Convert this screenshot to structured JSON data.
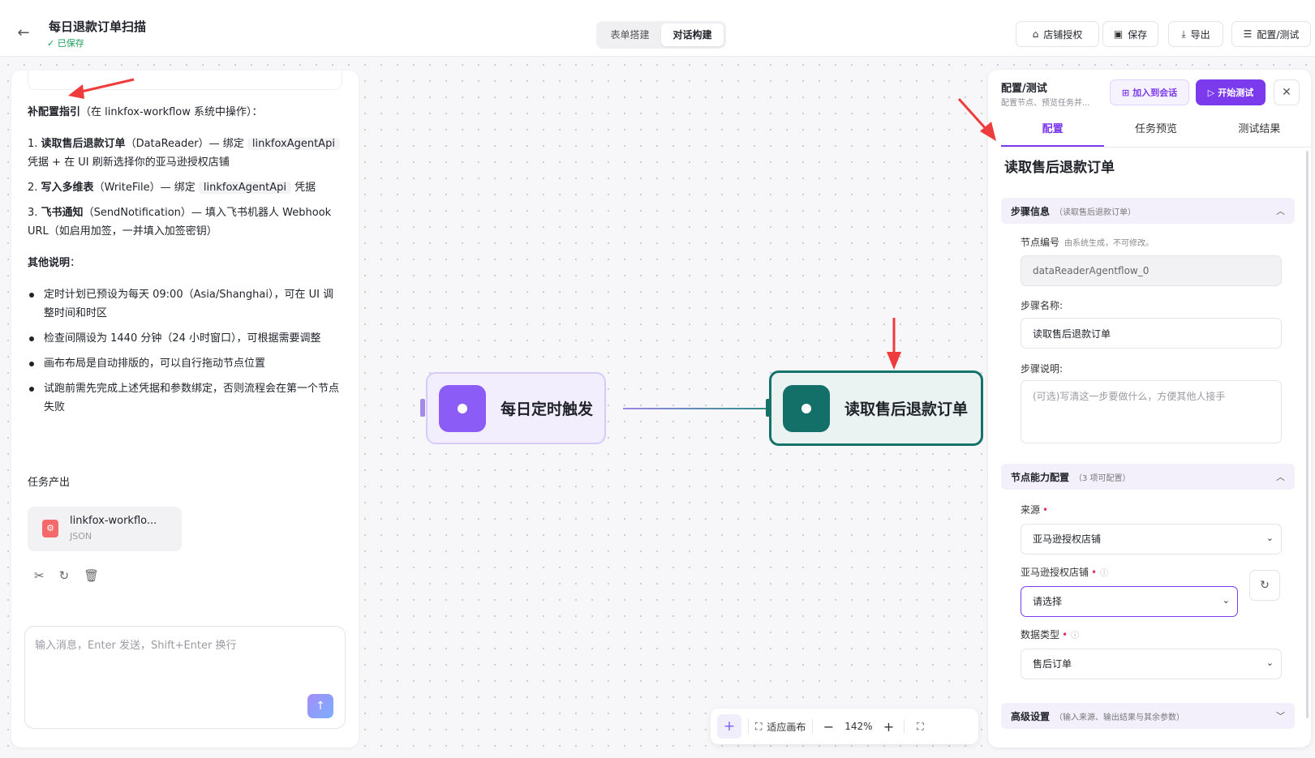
{
  "header": {
    "back_icon": "arrow-left-icon",
    "title": "每日退款订单扫描",
    "saved_status": "✓ 已保存",
    "mode_tabs": [
      "表单搭建",
      "对话构建"
    ],
    "active_mode": "对话构建",
    "actions": {
      "store_auth": "店铺授权",
      "save": "保存",
      "export": "导出",
      "config_test": "配置/测试"
    }
  },
  "chat": {
    "guide_title": "补配置指引",
    "guide_context": "（在 linkfox-workflow 系统中操作）：",
    "steps": [
      {
        "num": "1.",
        "name": "读取售后退款订单",
        "desc_a": "（DataReader）— 绑定 ",
        "code": "linkfoxAgentApi",
        "desc_b": " 凭据 + 在 UI 刷新选择你的亚马逊授权店铺"
      },
      {
        "num": "2.",
        "name": "写入多维表",
        "desc_a": "（WriteFile）— 绑定 ",
        "code": "linkfoxAgentApi",
        "desc_b": " 凭据"
      },
      {
        "num": "3.",
        "name": "飞书通知",
        "desc_a": "（SendNotification）— 填入飞书机器人 Webhook URL（如启用加签，一并填入加签密钥）",
        "code": "",
        "desc_b": ""
      }
    ],
    "other_title": "其他说明",
    "other_colon": "：",
    "notes": [
      "定时计划已预设为每天 09:00（Asia/Shanghai），可在 UI 调整时间和时区",
      "检查间隔设为 1440 分钟（24 小时窗口），可根据需要调整",
      "画布布局是自动排版的，可以自行拖动节点位置",
      "试跑前需先完成上述凭据和参数绑定，否则流程会在第一个节点失败"
    ],
    "output_label": "任务产出",
    "file": {
      "name": "linkfox-workflo...",
      "type": "JSON"
    },
    "input_placeholder": "输入消息，Enter 发送，Shift+Enter 换行"
  },
  "canvas": {
    "nodes": [
      {
        "label": "每日定时触发",
        "color": "#8b5cf6"
      },
      {
        "label": "读取售后退款订单",
        "color": "#137068"
      }
    ],
    "zoom": {
      "fit_label": "适应画布",
      "zoom_level": "142%"
    }
  },
  "panel": {
    "title": "配置/测试",
    "subtitle": "配置节点、预览任务并...",
    "add_to_chat": "加入到会话",
    "start_test": "开始测试",
    "tabs": [
      "配置",
      "任务预览",
      "测试结果"
    ],
    "active_tab": "配置",
    "node_title": "读取售后退款订单",
    "step_info": {
      "title": "步骤信息",
      "hint": "（读取售后退款订单）",
      "node_id_label": "节点编号",
      "node_id_note": "由系统生成，不可修改。",
      "node_id_value": "dataReaderAgentflow_0",
      "step_name_label": "步骤名称:",
      "step_name_value": "读取售后退款订单",
      "step_desc_label": "步骤说明:",
      "step_desc_placeholder": "(可选)写清这一步要做什么，方便其他人接手"
    },
    "capability": {
      "title": "节点能力配置",
      "hint": "（3 项可配置）",
      "source_label": "来源",
      "source_value": "亚马逊授权店铺",
      "store_label": "亚马逊授权店铺",
      "store_value": "请选择",
      "datatype_label": "数据类型",
      "datatype_value": "售后订单"
    },
    "advanced": {
      "title": "高级设置",
      "hint": "（输入来源、输出结果与其余参数）"
    }
  },
  "colors": {
    "accent": "#7c3aed",
    "node_teal": "#137068",
    "annotation_arrow": "#ee3b3b"
  }
}
